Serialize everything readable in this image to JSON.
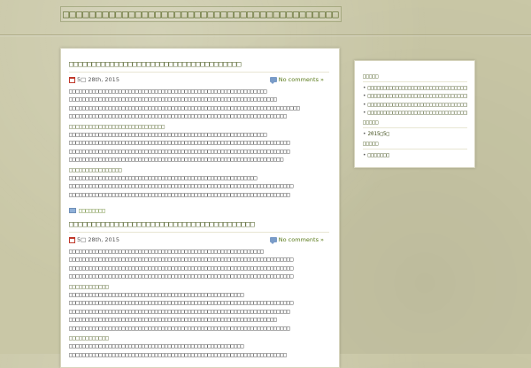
{
  "site": {
    "title": "□□□□□□□□□□□□□□□□□□□□□□□□□□□□□□□□□□□□□□□□□□"
  },
  "posts": [
    {
      "title": "□□□□□□□□□□□□□□□□□□□□□□□□□□□□□□□□□□□□□□",
      "date": "5□ 28th, 2015",
      "comments": "No comments »",
      "lines": [
        "□□□□□□□□□□□□□□□□□□□□□□□□□□□□□□□□□□□□□□□□□□□□□□□□□□□□□□□□□□□□",
        "□□□□□□□□□□□□□□□□□□□□□□□□□□□□□□□□□□□□□□□□□□□□□□□□□□□□□□□□□□□□□□□",
        "□□□□□□□□□□□□□□□□□□□□□□□□□□□□□□□□□□□□□□□□□□□□□□□□□□□□□□□□□□□□□□□□□□□□□□",
        "□□□□□□□□□□□□□□□□□□□□□□□□□□□□□□□□□□□□□□□□□□□□□□□□□□□□□□□□□□□□□□□□□□"
      ],
      "sections": [
        {
          "heading": "□□□□□□□□□□□□□□□□□□□□□□□□□□□□□",
          "lines": [
            "□□□□□□□□□□□□□□□□□□□□□□□□□□□□□□□□□□□□□□□□□□□□□□□□□□□□□□□□□□□□",
            "□□□□□□□□□□□□□□□□□□□□□□□□□□□□□□□□□□□□□□□□□□□□□□□□□□□□□□□□□□□□□□□□□□□",
            "□□□□□□□□□□□□□□□□□□□□□□□□□□□□□□□□□□□□□□□□□□□□□□□□□□□□□□□□□□□□□□□□□□□",
            "□□□□□□□□□□□□□□□□□□□□□□□□□□□□□□□□□□□□□□□□□□□□□□□□□□□□□□□□□□□□□□□□□"
          ]
        },
        {
          "heading": "□□□□□□□□□□□□□□□□",
          "lines": [
            "□□□□□□□□□□□□□□□□□□□□□□□□□□□□□□□□□□□□□□□□□□□□□□□□□□□□□□□□□",
            "□□□□□□□□□□□□□□□□□□□□□□□□□□□□□□□□□□□□□□□□□□□□□□□□□□□□□□□□□□□□□□□□□□□□",
            "□□□□□□□□□□□□□□□□□□□□□□□□□□□□□□□□□□□□□□□□□□□□□□□□□□□□□□□□□□□□□□□□□□□"
          ]
        }
      ],
      "category": "□□□□□□□□"
    },
    {
      "title": "□□□□□□□□□□□□□□□□□□□□□□□□□□□□□□□□□□□□□□□□□",
      "date": "5□ 28th, 2015",
      "comments": "No comments »",
      "lines": [
        "□□□□□□□□□□□□□□□□□□□□□□□□□□□□□□□□□□□□□□□□□□□□□□□□□□□□□□□□□□□",
        "□□□□□□□□□□□□□□□□□□□□□□□□□□□□□□□□□□□□□□□□□□□□□□□□□□□□□□□□□□□□□□□□□□□□",
        "□□□□□□□□□□□□□□□□□□□□□□□□□□□□□□□□□□□□□□□□□□□□□□□□□□□□□□□□□□□□□□□□□□□□",
        "□□□□□□□□□□□□□□□□□□□□□□□□□□□□□□□□□□□□□□□□□□□□□□□□□□□□□□□□□□□□□□□□□□□□"
      ],
      "sections": [
        {
          "heading": "□□□□□□□□□□□□",
          "lines": [
            "□□□□□□□□□□□□□□□□□□□□□□□□□□□□□□□□□□□□□□□□□□□□□□□□□□□□□",
            "□□□□□□□□□□□□□□□□□□□□□□□□□□□□□□□□□□□□□□□□□□□□□□□□□□□□□□□□□□□□□□□□□□□□",
            "□□□□□□□□□□□□□□□□□□□□□□□□□□□□□□□□□□□□□□□□□□□□□□□□□□□□□□□□□□□□□□□□□□□",
            "□□□□□□□□□□□□□□□□□□□□□□□□□□□□□□□□□□□□□□□□□□□□□□□□□□□□□□□□□□□□□□□",
            "□□□□□□□□□□□□□□□□□□□□□□□□□□□□□□□□□□□□□□□□□□□□□□□□□□□□□□□□□□□□□□□□□□□"
          ]
        },
        {
          "heading": "□□□□□□□□□□□□",
          "lines": [
            "□□□□□□□□□□□□□□□□□□□□□□□□□□□□□□□□□□□□□□□□□□□□□□□□□□□□□",
            "□□□□□□□□□□□□□□□□□□□□□□□□□□□□□□□□□□□□□□□□□□□□□□□□□□□□□□□□□□□□□□□□□□"
          ]
        }
      ]
    }
  ],
  "sidebar": {
    "widgets": [
      {
        "title": "□□□□□",
        "items": [
          "□□□□□□□□□□□□□□□□□□□□□□□□□□□□□□□□□□□□",
          "□□□□□□□□□□□□□□□□□□□□□□□□□□□□□□□□□□□□□□□□",
          "□□□□□□□□□□□□□□□□□□□□□□□□□□□□□□□□□□□□□□",
          "□□□□□□□□□□□□□□□□□□□□□□□□□□□□□□□□□"
        ]
      },
      {
        "title": "□□□□□",
        "items": [
          "2015□5□"
        ]
      },
      {
        "title": "□□□□□",
        "items": [
          "□□□□□□□"
        ]
      }
    ]
  }
}
